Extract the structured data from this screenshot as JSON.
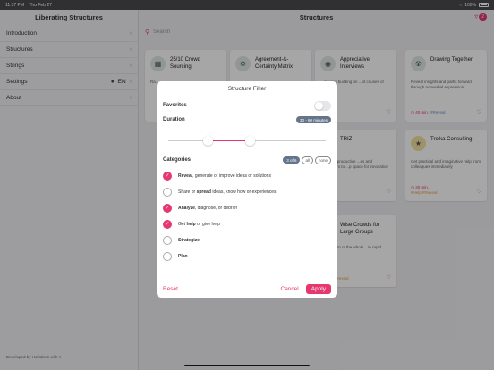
{
  "status_bar": {
    "time": "11:37 PM",
    "date": "Thu Feb 27",
    "battery": "100%"
  },
  "sidebar": {
    "title": "Liberating Structures",
    "items": [
      {
        "label": "Introduction"
      },
      {
        "label": "Structures"
      },
      {
        "label": "Strings"
      },
      {
        "label": "Settings",
        "value": "EN"
      },
      {
        "label": "About"
      }
    ],
    "footer": "Developed by Holisticon with"
  },
  "main": {
    "title": "Structures",
    "filter_count": "2",
    "search_placeholder": "Search",
    "cards": [
      {
        "title": "25/10 Crowd Sourcing",
        "desc": "Ra...",
        "meta": "",
        "tag": ""
      },
      {
        "title": "Agreement-&-Certainty Matrix",
        "desc": "",
        "meta": "",
        "tag": ""
      },
      {
        "title": "Appreciative Interviews",
        "desc": "...ing and building on ...ot causes of success",
        "meta": "",
        "tag": "#Spread"
      },
      {
        "title": "Drawing Together",
        "desc": "Reveal insights and paths forward through nonverbal expression",
        "meta": "40 min.",
        "tag": "#Reveal"
      },
      {
        "title": "TRIZ",
        "desc": "...counterproductive ...es and behaviours to ...p space for innovation",
        "meta": "",
        "tag": "#Reveal"
      },
      {
        "title": "Troika Consulting",
        "desc": "Get practical and imaginative help from colleagues immediately",
        "meta": "30 min.",
        "tag": "#Help #Reveal"
      },
      {
        "title": "Wise Crowds for Large Groups",
        "desc": "...e wisdom of the whole ...in rapid cycles",
        "meta": "",
        "tag": "#Help #Reveal"
      }
    ]
  },
  "modal": {
    "title": "Structure Filter",
    "favorites_label": "Favorites",
    "favorites_on": false,
    "duration_label": "Duration",
    "duration_value": "30 - 60 minutes",
    "duration_range": [
      0.25,
      0.52
    ],
    "categories_label": "Categories",
    "categories_count": "3 of 6",
    "all_label": "all",
    "none_label": "none",
    "categories": [
      {
        "bold": "Reveal",
        "rest": ", generate or improve ideas or solutions",
        "checked": true
      },
      {
        "pre": "Share or ",
        "bold": "spread",
        "rest": " ideas, know how or experiences",
        "checked": false
      },
      {
        "bold": "Analyze",
        "rest": ", diagnose, or debrief",
        "checked": true
      },
      {
        "pre": "Get ",
        "bold": "help",
        "rest": " or give help",
        "checked": true
      },
      {
        "bold": "Strategize",
        "rest": "",
        "checked": false
      },
      {
        "bold": "Plan",
        "rest": "",
        "checked": false
      }
    ],
    "reset_label": "Reset",
    "cancel_label": "Cancel",
    "apply_label": "Apply"
  }
}
